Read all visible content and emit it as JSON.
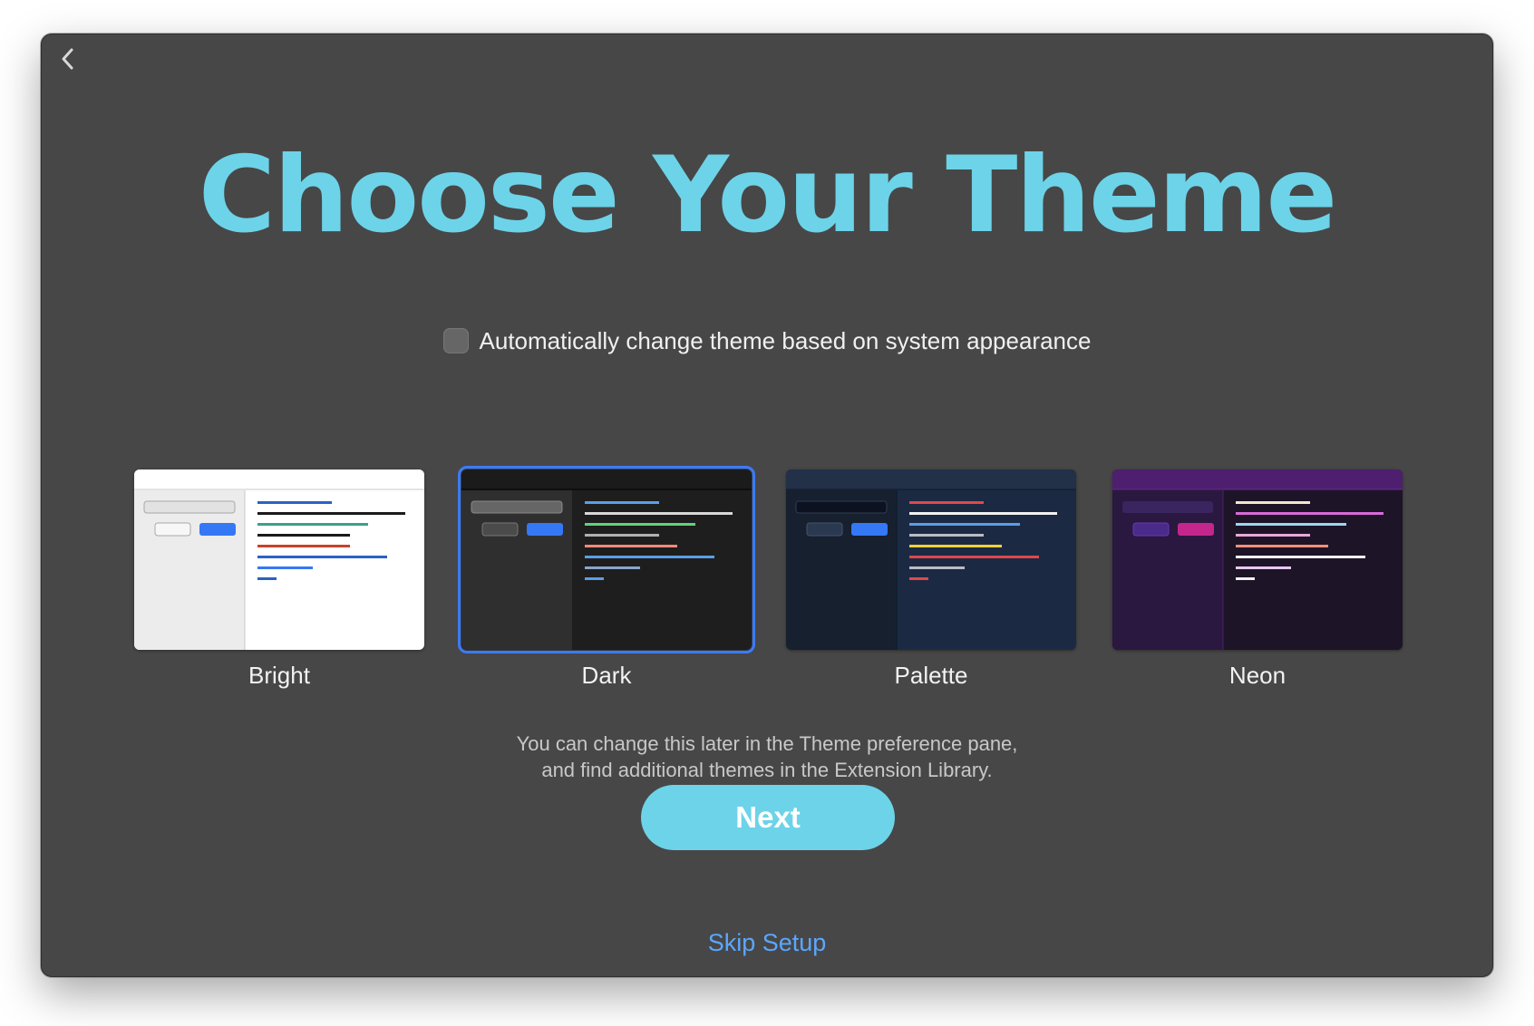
{
  "window": {
    "back_icon": "chevron-left-icon"
  },
  "title": "Choose Your Theme",
  "auto_theme": {
    "label": "Automatically change theme based on system appearance",
    "checked": false
  },
  "themes": [
    {
      "id": "bright",
      "label": "Bright",
      "selected": false
    },
    {
      "id": "dark",
      "label": "Dark",
      "selected": true
    },
    {
      "id": "palette",
      "label": "Palette",
      "selected": false
    },
    {
      "id": "neon",
      "label": "Neon",
      "selected": false
    }
  ],
  "helper_text": {
    "line1": "You can change this later in the Theme preference pane,",
    "line2": "and find additional themes in the Extension Library."
  },
  "next_label": "Next",
  "skip_label": "Skip Setup",
  "colors": {
    "accent": "#6dd3e8",
    "window_bg": "#474747",
    "link": "#5ba7ff",
    "selection": "#3a7bff"
  }
}
